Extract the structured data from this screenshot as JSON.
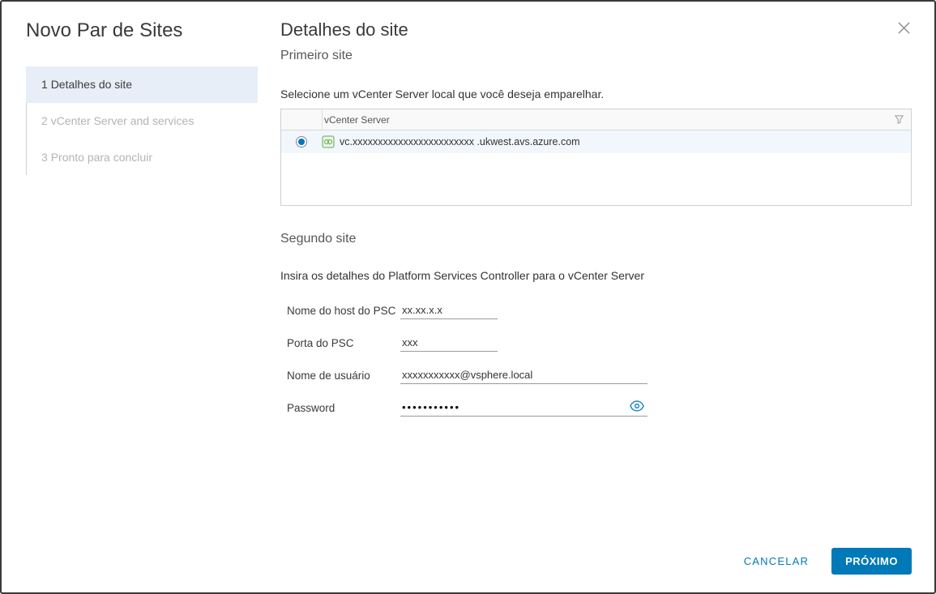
{
  "sidebar": {
    "title": "Novo Par de Sites",
    "steps": [
      {
        "num": "1",
        "label": "Detalhes do site"
      },
      {
        "num": "2",
        "label": "vCenter Server and services"
      },
      {
        "num": "3",
        "label": "Pronto para concluir"
      }
    ]
  },
  "header": {
    "title": "Detalhes do site",
    "subtitle": "Primeiro site"
  },
  "firstSite": {
    "instruction": "Selecione um vCenter Server local que você deseja emparelhar.",
    "column_header": "vCenter Server",
    "rows": [
      {
        "server": "vc.xxxxxxxxxxxxxxxxxxxxxxxx .ukwest.avs.azure.com",
        "selected": true
      }
    ]
  },
  "secondSite": {
    "title": "Segundo site",
    "instruction": "Insira os detalhes do Platform Services Controller para o vCenter Server",
    "fields": {
      "psc_host_label": "Nome do host do PSC",
      "psc_host_value": "xx.xx.x.x",
      "psc_port_label": "Porta do PSC",
      "psc_port_value": "xxx",
      "username_label": "Nome de usuário",
      "username_value": "xxxxxxxxxxx@vsphere.local",
      "password_label": "Password",
      "password_value": "•••••••••••"
    }
  },
  "footer": {
    "cancel": "CANCELAR",
    "next": "PRÓXIMO"
  }
}
